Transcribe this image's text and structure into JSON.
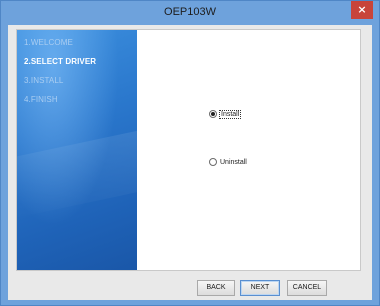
{
  "window": {
    "title": "OEP103W",
    "close_glyph": "×"
  },
  "sidebar": {
    "steps": [
      {
        "label": "1.WELCOME",
        "active": false
      },
      {
        "label": "2.SELECT DRIVER",
        "active": true
      },
      {
        "label": "3.INSTALL",
        "active": false
      },
      {
        "label": "4.FINISH",
        "active": false
      }
    ]
  },
  "options": {
    "install": {
      "label": "Install",
      "selected": true
    },
    "uninstall": {
      "label": "Uninstall",
      "selected": false
    }
  },
  "buttons": {
    "back": "BACK",
    "next": "NEXT",
    "cancel": "CANCEL"
  },
  "colors": {
    "titlebar": "#6ea2dc",
    "close": "#c8443a",
    "sidebar": "#2a77cc"
  }
}
